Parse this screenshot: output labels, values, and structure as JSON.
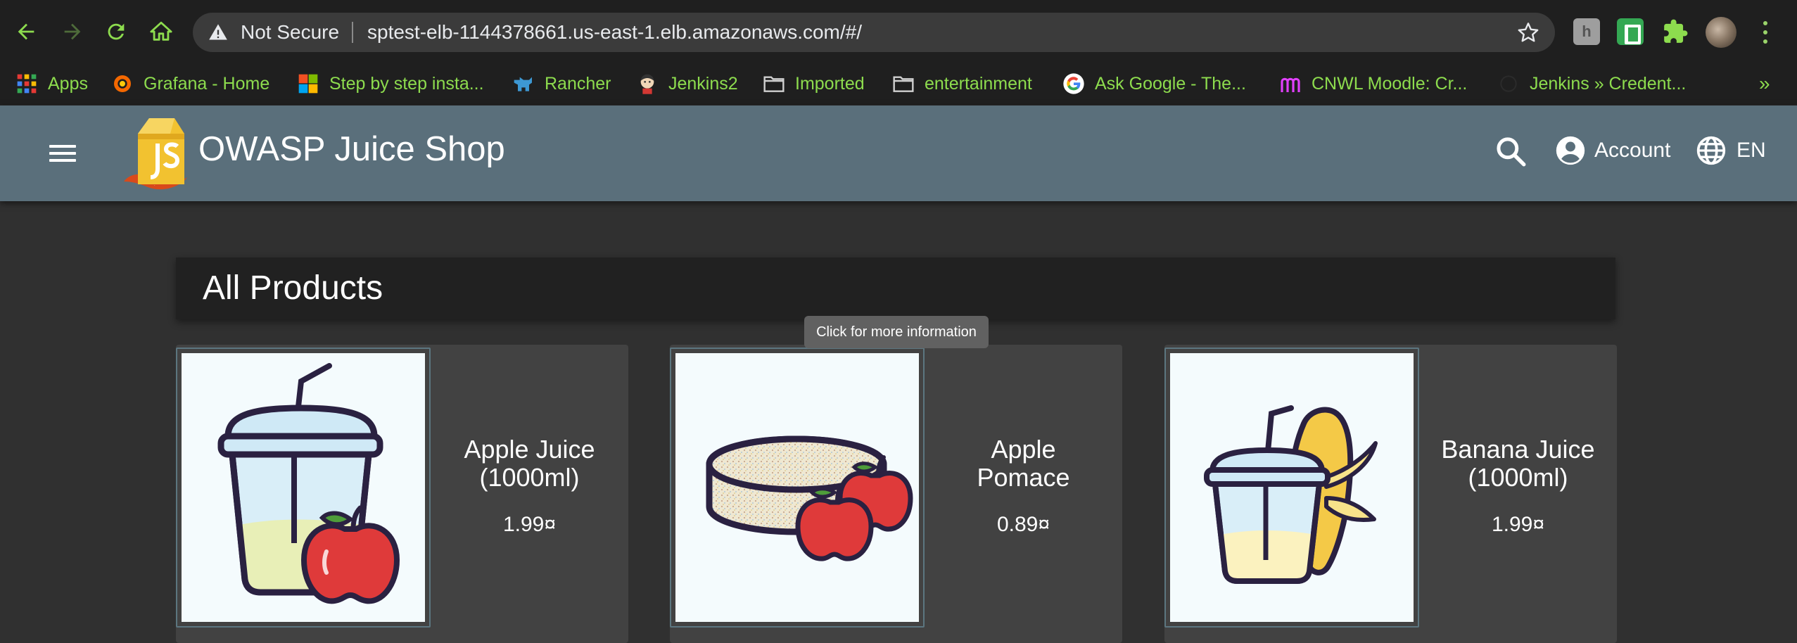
{
  "browser": {
    "security_label": "Not Secure",
    "url": "sptest-elb-1144378661.us-east-1.elb.amazonaws.com/#/",
    "extension_letter": "h",
    "bookmarks": [
      {
        "label": "Apps",
        "icon": "apps-grid-icon"
      },
      {
        "label": "Grafana - Home",
        "icon": "grafana-icon"
      },
      {
        "label": "Step by step insta...",
        "icon": "windows-icon"
      },
      {
        "label": "Rancher",
        "icon": "rancher-icon"
      },
      {
        "label": "Jenkins2",
        "icon": "jenkins-icon"
      },
      {
        "label": "Imported",
        "icon": "folder-icon"
      },
      {
        "label": "entertainment",
        "icon": "folder-icon"
      },
      {
        "label": "Ask Google - The...",
        "icon": "google-icon"
      },
      {
        "label": "CNWL Moodle: Cr...",
        "icon": "moodle-icon"
      },
      {
        "label": "Jenkins » Credent...",
        "icon": "jenkins-icon"
      }
    ],
    "overflow": "»",
    "colors": {
      "bookmark_text": "#8ddc4e",
      "chrome_bg": "#1f1f1f"
    }
  },
  "app": {
    "title": "OWASP Juice Shop",
    "logo_text": "JS",
    "account_label": "Account",
    "language_label": "EN",
    "header_color": "#5a6f7b"
  },
  "main": {
    "heading": "All Products",
    "tooltip": "Click for more information",
    "products": [
      {
        "name_line1": "Apple Juice",
        "name_line2": "(1000ml)",
        "price": "1.99¤",
        "image": "apple-juice-image"
      },
      {
        "name_line1": "Apple",
        "name_line2": "Pomace",
        "price": "0.89¤",
        "image": "apple-pomace-image"
      },
      {
        "name_line1": "Banana Juice",
        "name_line2": "(1000ml)",
        "price": "1.99¤",
        "image": "banana-juice-image"
      }
    ]
  }
}
